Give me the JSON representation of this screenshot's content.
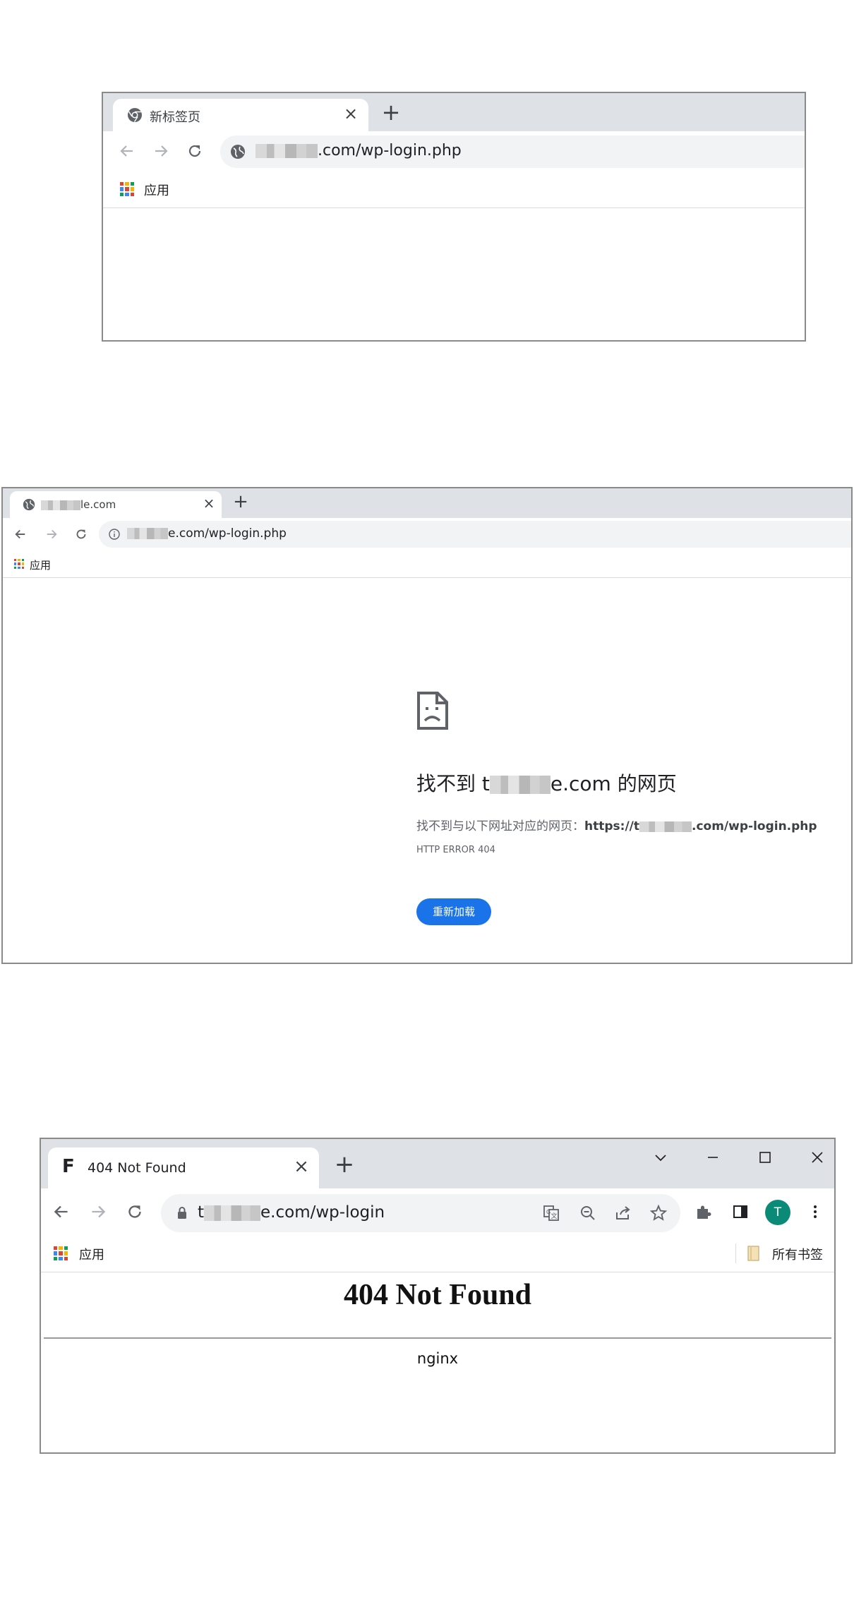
{
  "window1": {
    "tab_title": "新标签页",
    "tab_close": "×",
    "new_tab": "+",
    "url_suffix": ".com/wp-login.php",
    "bookmark_apps": "应用"
  },
  "window2": {
    "tab_title_suffix": "le.com",
    "tab_close": "×",
    "new_tab": "+",
    "url_suffix": "e.com/wp-login.php",
    "bookmark_apps": "应用",
    "error": {
      "heading_prefix": "找不到 t",
      "heading_suffix": "e.com 的网页",
      "detail_prefix": "找不到与以下网址对应的网页：",
      "detail_url_prefix": "https://t",
      "detail_url_suffix": ".com/wp-login.php",
      "code": "HTTP ERROR 404",
      "reload_button": "重新加载"
    }
  },
  "window3": {
    "tab_title": "404 Not Found",
    "tab_favicon": "F",
    "tab_close": "×",
    "new_tab": "+",
    "url_prefix": "t",
    "url_suffix": "e.com/wp-login",
    "bookmark_apps": "应用",
    "bookmark_all": "所有书签",
    "profile_initial": "T",
    "page_heading": "404 Not Found",
    "page_server": "nginx",
    "colors": {
      "profile_bg": "#0b8a78"
    }
  },
  "colors": {
    "tabstrip": "#dee1e6",
    "omnibox": "#f1f3f4",
    "reload_button": "#1a73e8",
    "window_border": "#8a8a8a"
  }
}
